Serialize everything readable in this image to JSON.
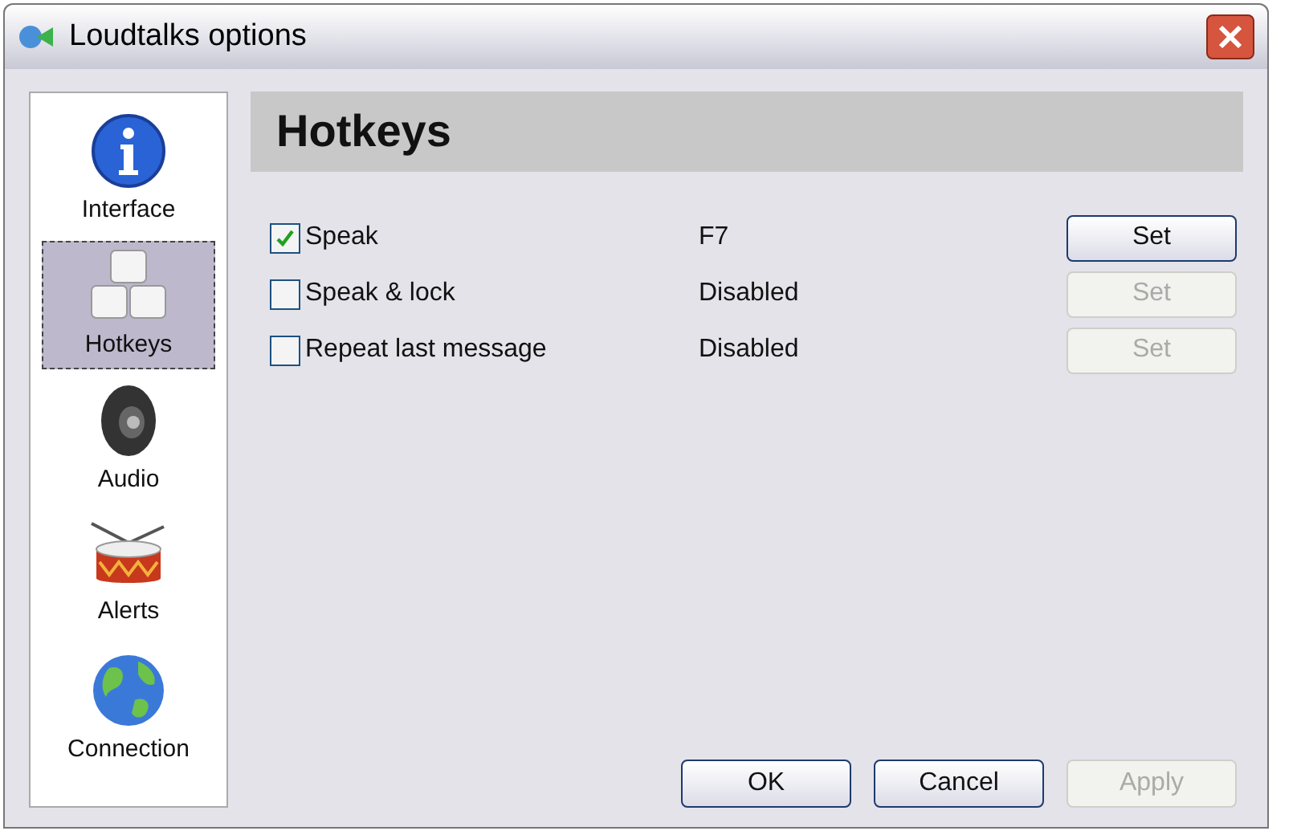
{
  "window": {
    "title": "Loudtalks options"
  },
  "sidebar": {
    "items": [
      {
        "label": "Interface",
        "kind": "info",
        "selected": false
      },
      {
        "label": "Hotkeys",
        "kind": "keys",
        "selected": true
      },
      {
        "label": "Audio",
        "kind": "speaker",
        "selected": false
      },
      {
        "label": "Alerts",
        "kind": "drum",
        "selected": false
      },
      {
        "label": "Connection",
        "kind": "globe",
        "selected": false
      }
    ]
  },
  "page": {
    "heading": "Hotkeys"
  },
  "hotkeys": [
    {
      "label": "Speak",
      "checked": true,
      "key": "F7",
      "button": "Set",
      "disabled": false
    },
    {
      "label": "Speak & lock",
      "checked": false,
      "key": "Disabled",
      "button": "Set",
      "disabled": true
    },
    {
      "label": "Repeat last message",
      "checked": false,
      "key": "Disabled",
      "button": "Set",
      "disabled": true
    }
  ],
  "buttons": [
    {
      "label": "OK",
      "disabled": false
    },
    {
      "label": "Cancel",
      "disabled": false
    },
    {
      "label": "Apply",
      "disabled": true
    }
  ]
}
